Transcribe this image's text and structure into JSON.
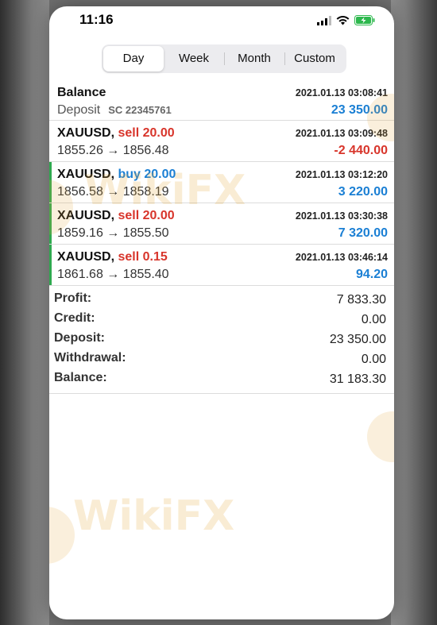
{
  "status_bar": {
    "time": "11:16"
  },
  "tabs": [
    {
      "label": "Day",
      "selected": true
    },
    {
      "label": "Week",
      "selected": false
    },
    {
      "label": "Month",
      "selected": false
    },
    {
      "label": "Custom",
      "selected": false
    }
  ],
  "rows": [
    {
      "title": "Balance",
      "sub_label": "Deposit",
      "sub_code": "SC 22345761",
      "timestamp": "2021.01.13 03:08:41",
      "amount": "23 350.00"
    },
    {
      "symbol": "XAUUSD,",
      "side": "sell 20.00",
      "prices": "1855.26 → 1856.48",
      "timestamp": "2021.01.13 03:09:48",
      "amount": "-2 440.00"
    },
    {
      "symbol": "XAUUSD,",
      "side": "buy 20.00",
      "prices": "1856.58 → 1858.19",
      "timestamp": "2021.01.13 03:12:20",
      "amount": "3 220.00"
    },
    {
      "symbol": "XAUUSD,",
      "side": "sell 20.00",
      "prices": "1859.16 → 1855.50",
      "timestamp": "2021.01.13 03:30:38",
      "amount": "7 320.00"
    },
    {
      "symbol": "XAUUSD,",
      "side": "sell 0.15",
      "prices": "1861.68 → 1855.40",
      "timestamp": "2021.01.13 03:46:14",
      "amount": "94.20"
    }
  ],
  "summary": {
    "profit_label": "Profit:",
    "profit": "7 833.30",
    "credit_label": "Credit:",
    "credit": "0.00",
    "deposit_label": "Deposit:",
    "deposit": "23 350.00",
    "withdrawal_label": "Withdrawal:",
    "withdrawal": "0.00",
    "balance_label": "Balance:",
    "balance": "31 183.30"
  },
  "watermark": "WikiFX",
  "colors": {
    "sell": "#d8352b",
    "buy": "#1a7fd4",
    "row_bar": "#2fa84f"
  }
}
